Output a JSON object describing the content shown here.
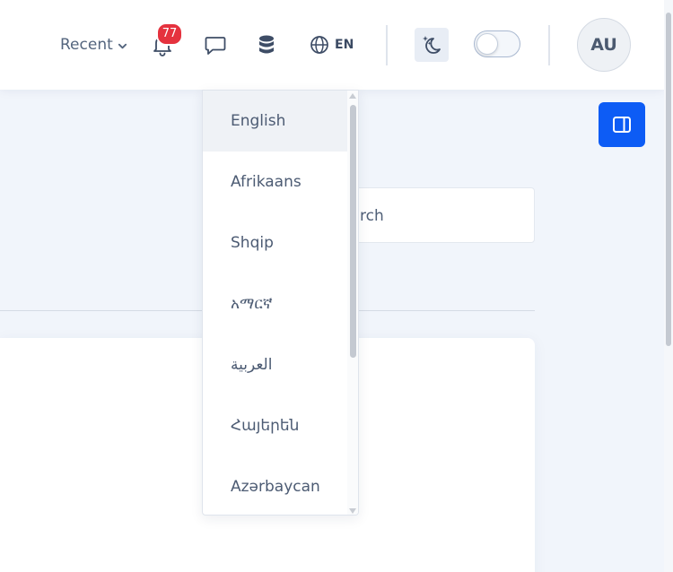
{
  "header": {
    "recent_label": "Recent",
    "notifications_count": "77",
    "language_code": "EN",
    "avatar_initials": "AU",
    "theme_toggle_on": false
  },
  "search": {
    "visible_text": "rch"
  },
  "language_dropdown": {
    "selected": "English",
    "items": [
      {
        "label": "English"
      },
      {
        "label": "Afrikaans"
      },
      {
        "label": "Shqip"
      },
      {
        "label": "አማርኛ"
      },
      {
        "label": "العربية"
      },
      {
        "label": "Հայերեն"
      },
      {
        "label": "Azərbaycan"
      }
    ]
  },
  "colors": {
    "accent": "#0d5cf5",
    "badge": "#e5323e",
    "background": "#f1f5fb"
  },
  "icons": {
    "bell": "bell-icon",
    "chat": "chat-icon",
    "database": "database-icon",
    "globe": "globe-icon",
    "moon": "moon-stars-icon",
    "panel": "sidebar-panel-icon",
    "chevron": "chevron-down-icon"
  }
}
